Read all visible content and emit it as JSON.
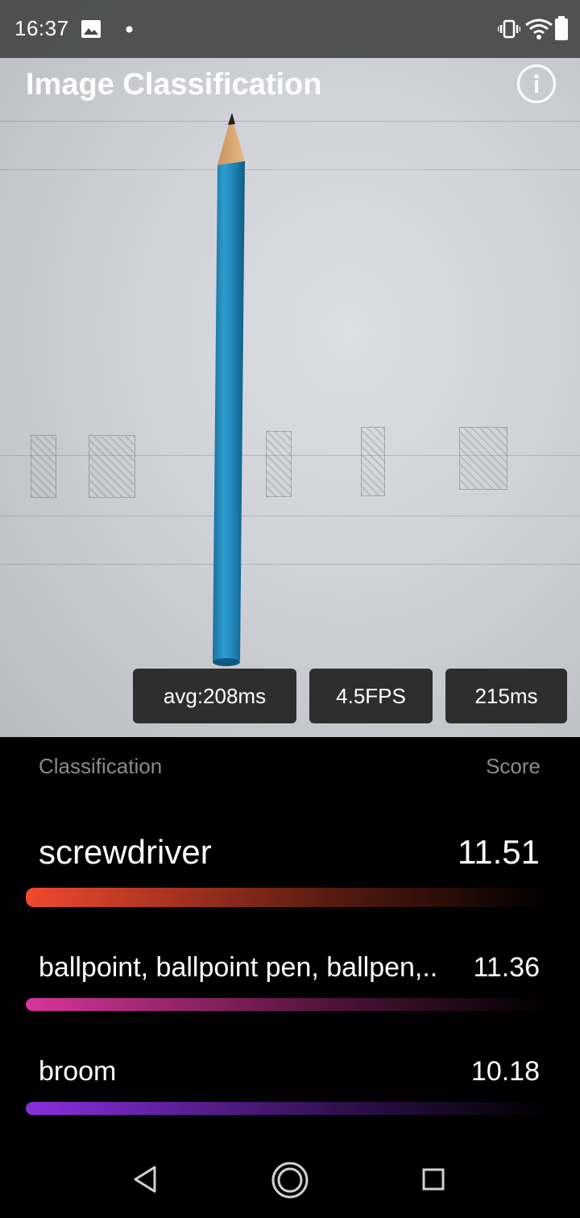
{
  "status_bar": {
    "time": "16:37",
    "icons": [
      "image-icon",
      "dot-icon",
      "vibrate-icon",
      "wifi-icon",
      "battery-icon"
    ]
  },
  "app": {
    "title": "Image Classification",
    "info_icon": "info-icon"
  },
  "camera_preview": {
    "subject": "pencil"
  },
  "metrics": {
    "avg": "avg:208ms",
    "fps": "4.5FPS",
    "latency": "215ms"
  },
  "results_header": {
    "classification": "Classification",
    "score": "Score"
  },
  "results": [
    {
      "label": "screwdriver",
      "score": "11.51",
      "color": "#f04a2e"
    },
    {
      "label": "ballpoint, ballpoint pen, ballpen,..",
      "score": "11.36",
      "color": "#d8359b"
    },
    {
      "label": "broom",
      "score": "10.18",
      "color": "#8a2ee0"
    }
  ],
  "nav": {
    "back": "back-icon",
    "home": "home-icon",
    "recents": "recents-icon"
  }
}
